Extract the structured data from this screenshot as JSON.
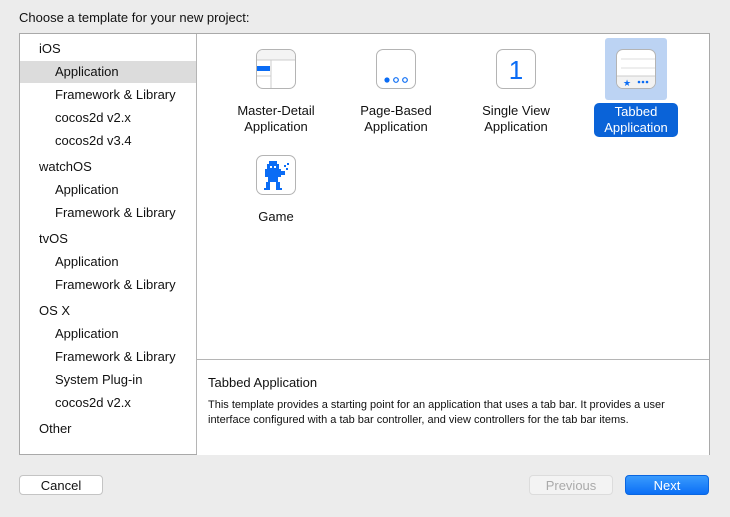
{
  "dialog": {
    "title": "Choose a template for your new project:"
  },
  "sidebar": {
    "rows": [
      {
        "label": "iOS",
        "type": "header"
      },
      {
        "label": "Application",
        "type": "item",
        "selected": true
      },
      {
        "label": "Framework & Library",
        "type": "item"
      },
      {
        "label": "cocos2d v2.x",
        "type": "item"
      },
      {
        "label": "cocos2d v3.4",
        "type": "item"
      },
      {
        "label": "watchOS",
        "type": "header"
      },
      {
        "label": "Application",
        "type": "item"
      },
      {
        "label": "Framework & Library",
        "type": "item"
      },
      {
        "label": "tvOS",
        "type": "header"
      },
      {
        "label": "Application",
        "type": "item"
      },
      {
        "label": "Framework & Library",
        "type": "item"
      },
      {
        "label": "OS X",
        "type": "header"
      },
      {
        "label": "Application",
        "type": "item"
      },
      {
        "label": "Framework & Library",
        "type": "item"
      },
      {
        "label": "System Plug-in",
        "type": "item"
      },
      {
        "label": "cocos2d v2.x",
        "type": "item"
      },
      {
        "label": "Other",
        "type": "header"
      }
    ]
  },
  "templates": [
    {
      "line1": "Master-Detail",
      "line2": "Application",
      "icon": "master-detail-icon"
    },
    {
      "line1": "Page-Based",
      "line2": "Application",
      "icon": "page-based-icon"
    },
    {
      "line1": "Single View",
      "line2": "Application",
      "icon": "single-view-icon",
      "glyph": "1"
    },
    {
      "line1": "Tabbed",
      "line2": "Application",
      "icon": "tabbed-icon",
      "selected": true
    },
    {
      "line1": "Game",
      "line2": "",
      "icon": "game-icon"
    }
  ],
  "description": {
    "title": "Tabbed Application",
    "text": "This template provides a starting point for an application that uses a tab bar. It provides a user interface configured with a tab bar controller, and view controllers for the tab bar items."
  },
  "buttons": {
    "cancel": "Cancel",
    "previous": "Previous",
    "next": "Next"
  },
  "colors": {
    "accent": "#0a63d8",
    "icon_blue": "#0a6cf5",
    "selection_bg": "#bcd3f3"
  }
}
